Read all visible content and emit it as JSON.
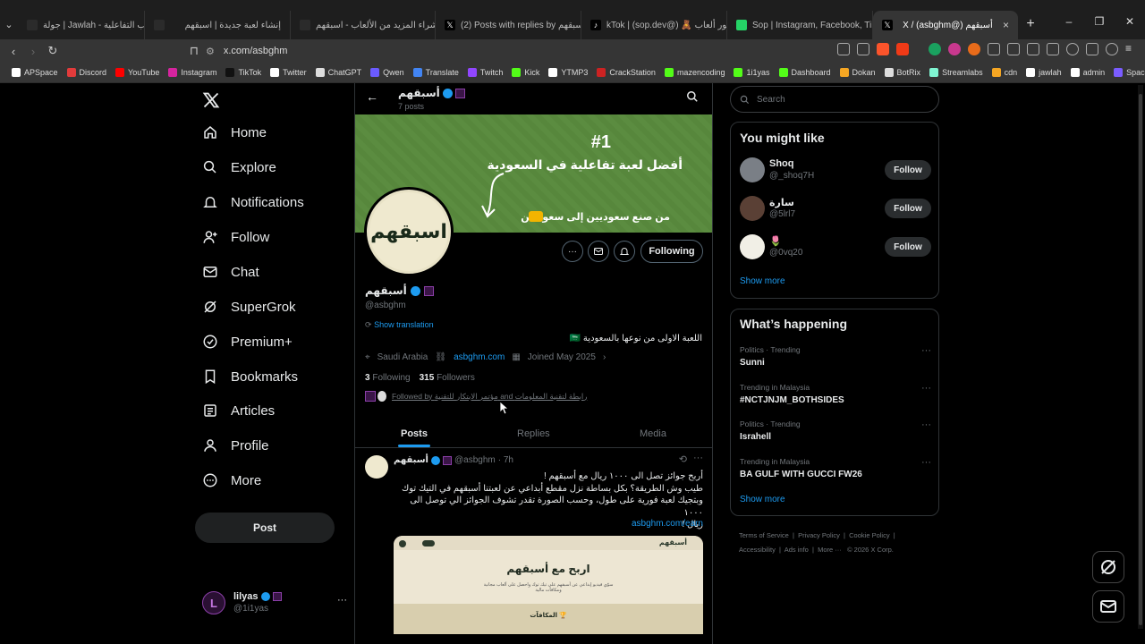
{
  "browser": {
    "tabs": [
      {
        "title": "جولة | Jawlah - منصة الألعاب التفاعلية",
        "active": false,
        "fav_color": "#2b2b2b"
      },
      {
        "title": "إنشاء لعبة جديدة | اسبقهم",
        "active": false,
        "fav_color": "#2b2b2b"
      },
      {
        "title": "شراء المزيد من الألعاب - اسبقهم",
        "active": false,
        "fav_color": "#2b2b2b"
      },
      {
        "title": "(2) Posts with replies by أسبقهم (@a",
        "active": false,
        "fav_color": "#000000"
      },
      {
        "title": "kTok | (sop.dev@) 🧸 مطور ألعاب",
        "active": false,
        "fav_color": "#000000"
      },
      {
        "title": "Sop | Instagram, Facebook, TikTok | L",
        "active": false,
        "fav_color": "#25d366"
      },
      {
        "title": "X / (asbghm@) أسبقهم",
        "active": true,
        "fav_color": "#000000"
      }
    ],
    "new_tab": "+",
    "window_controls": [
      "–",
      "❐",
      "✕"
    ],
    "url": "x.com/asbghm",
    "bookmarks": [
      {
        "label": "APSpace",
        "color": "#ffffff"
      },
      {
        "label": "Discord",
        "color": "#e23b3b"
      },
      {
        "label": "YouTube",
        "color": "#ff0000"
      },
      {
        "label": "Instagram",
        "color": "#d6249f"
      },
      {
        "label": "TikTok",
        "color": "#111111"
      },
      {
        "label": "Twitter",
        "color": "#ffffff"
      },
      {
        "label": "ChatGPT",
        "color": "#dddddd"
      },
      {
        "label": "Qwen",
        "color": "#6b5bff"
      },
      {
        "label": "Translate",
        "color": "#4285f4"
      },
      {
        "label": "Twitch",
        "color": "#9146ff"
      },
      {
        "label": "Kick",
        "color": "#53fc18"
      },
      {
        "label": "YTMP3",
        "color": "#ffffff"
      },
      {
        "label": "CrackStation",
        "color": "#cc2222"
      },
      {
        "label": "mazencoding",
        "color": "#53fc18"
      },
      {
        "label": "1i1yas",
        "color": "#53fc18"
      },
      {
        "label": "Dashboard",
        "color": "#53fc18"
      },
      {
        "label": "Dokan",
        "color": "#f5a623"
      },
      {
        "label": "BotRix",
        "color": "#dddddd"
      },
      {
        "label": "Streamlabs",
        "color": "#80f5d2"
      },
      {
        "label": "cdn",
        "color": "#f5a623"
      },
      {
        "label": "jawlah",
        "color": "#ffffff"
      },
      {
        "label": "admin",
        "color": "#ffffff"
      },
      {
        "label": "Spacemail",
        "color": "#7a5cff"
      }
    ],
    "bookmarks_more": "»"
  },
  "nav": {
    "logo": "X",
    "items": [
      {
        "label": "Home",
        "icon": "home-icon"
      },
      {
        "label": "Explore",
        "icon": "search-icon"
      },
      {
        "label": "Notifications",
        "icon": "bell-icon"
      },
      {
        "label": "Follow",
        "icon": "add-user-icon"
      },
      {
        "label": "Chat",
        "icon": "mail-icon"
      },
      {
        "label": "SuperGrok",
        "icon": "grok-icon"
      },
      {
        "label": "Premium+",
        "icon": "premium-icon"
      },
      {
        "label": "Bookmarks",
        "icon": "bookmark-icon"
      },
      {
        "label": "Articles",
        "icon": "articles-icon"
      },
      {
        "label": "Profile",
        "icon": "profile-icon"
      },
      {
        "label": "More",
        "icon": "more-circle-icon"
      }
    ],
    "post_label": "Post",
    "account": {
      "name": "lilyas",
      "handle": "@1i1yas",
      "more": "···"
    }
  },
  "profile": {
    "back": "←",
    "name": "أسبقهم",
    "posts_count": "7 posts",
    "banner": {
      "rank": "#1",
      "headline": "أفضل لعبة تفاعلية في السعودية",
      "sub": "من صنع سعوديين إلى سعوديين"
    },
    "avatar_text": "اسبقهم",
    "following_label": "Following",
    "handle": "@asbghm",
    "show_translation": "Show translation",
    "bio": "اللعبة الاولى من نوعها بالسعودية 🇸🇦",
    "location": "Saudi Arabia",
    "website": "asbghm.com",
    "joined": "Joined May 2025",
    "following_count": "3",
    "following_text": "Following",
    "followers_count": "315",
    "followers_text": "Followers",
    "followed_by": "Followed by مؤتمر الابتكار للتقنية and رابطة لتقنية المعلومات",
    "tabs": [
      "Posts",
      "Replies",
      "Media"
    ]
  },
  "post": {
    "name": "أسبقهم",
    "handle": "@asbghm",
    "time": "· 7h",
    "line1": "أربح جوائز تصل الى ١٠٠٠ ريال مع أسبقهم !",
    "line2": "طيب وش الطريقة؟ بكل بساطة نزل مقطع أبداعي عن لعبتنا أسبقهم في التيك توك",
    "line3": "وبتجيك لعبة فورية على طول، وحسب الصورة تقدر تشوف الجوائز الي توصل الى ١٠٠٠",
    "line4": "ريال !",
    "link": "asbghm.com/earn",
    "image": {
      "brand": "أسبقهم",
      "title": "اربح مع أسبقهم",
      "sub": "سوّي فيديو إبداعي عن أسبقهم على تيك توك واحصل على ألعاب مجانية ومكافآت مالية",
      "prizes": "المكافآت 🏆"
    }
  },
  "right": {
    "search_placeholder": "Search",
    "might_like_title": "You might like",
    "suggestions": [
      {
        "name": "Shoq",
        "handle": "@_shoq7H",
        "follow": "Follow",
        "color": "#7a7f86"
      },
      {
        "name": "سارة",
        "handle": "@5lrl7",
        "follow": "Follow",
        "color": "#5a4035"
      },
      {
        "name": "🌷",
        "handle": "@0vq20",
        "follow": "Follow",
        "color": "#f1efe6"
      }
    ],
    "show_more": "Show more",
    "happening_title": "What’s happening",
    "trends": [
      {
        "cat": "Politics · Trending",
        "title": "Sunni"
      },
      {
        "cat": "Trending in Malaysia",
        "title": "#NCTJNJM_BOTHSIDES"
      },
      {
        "cat": "Politics · Trending",
        "title": "Israhell"
      },
      {
        "cat": "Trending in Malaysia",
        "title": "BA GULF WITH GUCCI FW26"
      }
    ],
    "show_more2": "Show more",
    "footer": [
      "Terms of Service",
      "Privacy Policy",
      "Cookie Policy",
      "Accessibility",
      "Ads info",
      "More ···",
      "© 2026 X Corp."
    ]
  },
  "colors": {
    "accent": "#1d9bf0",
    "bg": "#000000",
    "banner": "#5a8a3e",
    "verified": "#1d9bf0",
    "business_badge": "#8b3fa8"
  }
}
